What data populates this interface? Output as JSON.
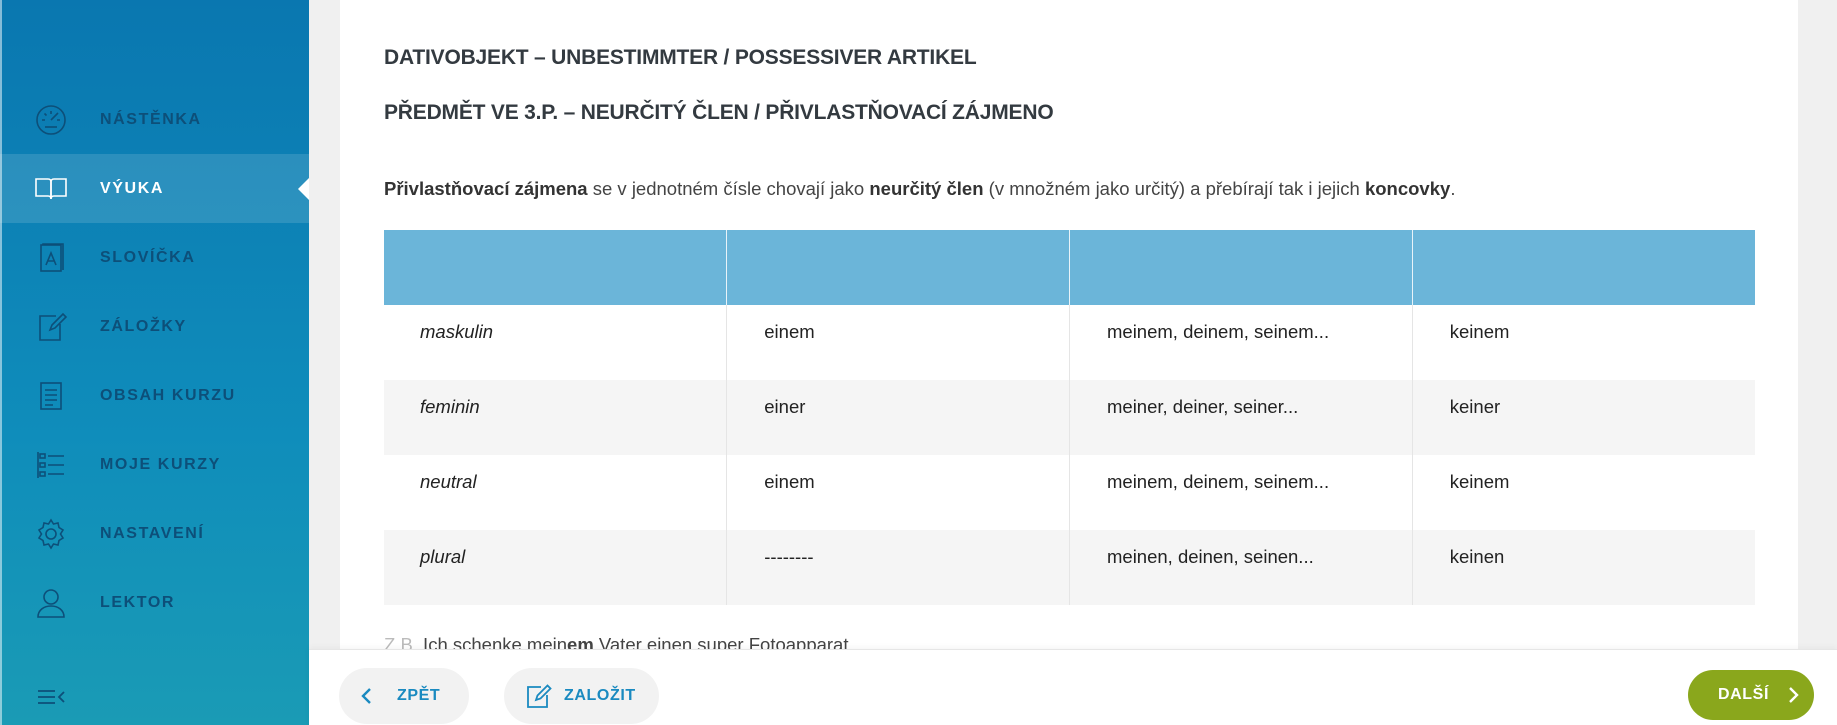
{
  "sidebar": {
    "items": [
      {
        "label": "NÁSTĚNKA",
        "icon": "dashboard-gauge-icon",
        "active": false
      },
      {
        "label": "VÝUKA",
        "icon": "open-book-icon",
        "active": true
      },
      {
        "label": "SLOVÍČKA",
        "icon": "vocabulary-card-icon",
        "active": false
      },
      {
        "label": "ZÁLOŽKY",
        "icon": "bookmark-edit-icon",
        "active": false
      },
      {
        "label": "OBSAH KURZU",
        "icon": "document-list-icon",
        "active": false
      },
      {
        "label": "MOJE KURZY",
        "icon": "checklist-icon",
        "active": false
      },
      {
        "label": "NASTAVENÍ",
        "icon": "gear-icon",
        "active": false
      },
      {
        "label": "LEKTOR",
        "icon": "person-icon",
        "active": false
      }
    ],
    "collapse_icon": "collapse-menu-icon"
  },
  "lesson": {
    "title_de": "DATIVOBJEKT – UNBESTIMMTER / POSSESSIVER ARTIKEL",
    "title_cs": "PŘEDMĚT VE 3.P. – NEURČITÝ ČLEN / PŘIVLASTŇOVACÍ ZÁJMENO",
    "intro": {
      "p1_bold": "Přivlastňovací zájmena",
      "p2": " se v jednotném čísle chovají jako ",
      "p3_bold": "neurčitý člen",
      "p4": " (v množném jako určitý) a přebírají tak i jejich ",
      "p5_bold": "koncovky",
      "p6": "."
    },
    "table": {
      "rows": [
        {
          "case": "maskulin",
          "indef": "einem",
          "possessive": "meinem, deinem, seinem...",
          "negative": "keinem"
        },
        {
          "case": "feminin",
          "indef": "einer",
          "possessive": "meiner, deiner, seiner...",
          "negative": "keiner"
        },
        {
          "case": "neutral",
          "indef": "einem",
          "possessive": "meinem, deinem, seinem...",
          "negative": "keinem"
        },
        {
          "case": "plural",
          "indef": "--------",
          "possessive": "meinen, deinen, seinen...",
          "negative": "keinen"
        }
      ]
    },
    "example": {
      "prefix": "Z.B.",
      "text_a": " Ich schenke mein",
      "text_bold": "em",
      "text_b": " Vater einen super Fotoapparat."
    }
  },
  "footer": {
    "back_label": "ZPĚT",
    "bookmark_label": "ZALOŽIT",
    "next_label": "DALŠÍ"
  },
  "colors": {
    "sidebar_top": "#0a77b0",
    "sidebar_bottom": "#1a9bb5",
    "table_header": "#6bb5d9",
    "next_button": "#8aa71c",
    "link_blue": "#1a8ac0"
  }
}
